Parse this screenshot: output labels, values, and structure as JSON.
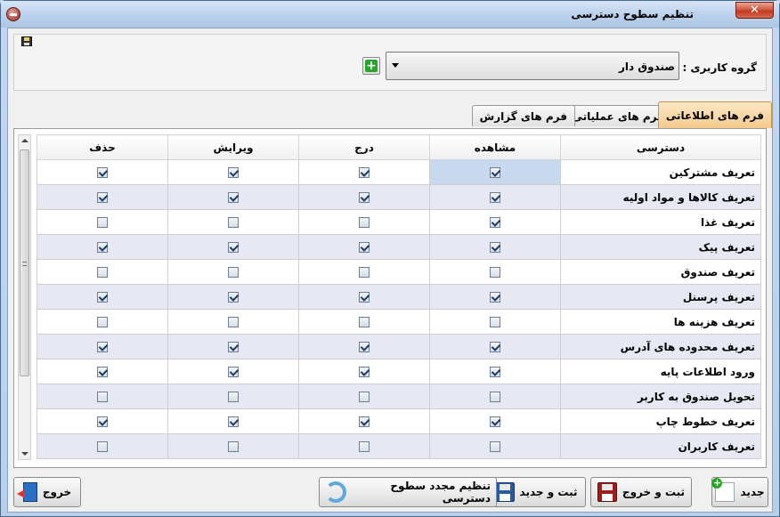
{
  "window": {
    "title": "تنظیم سطوح دسترسی",
    "close_label": "✕"
  },
  "group": {
    "label": "گروه کاربری :",
    "selected": "صندوق دار"
  },
  "tabs": [
    {
      "label": "فرم های اطلاعاتی",
      "active": true
    },
    {
      "label": "فرم های عملیاتی",
      "active": false
    },
    {
      "label": "فرم های گزارش",
      "active": false
    }
  ],
  "grid": {
    "columns": {
      "access": "دسترسی",
      "view": "مشاهده",
      "insert": "درج",
      "edit": "ویرایش",
      "delete": "حذف"
    },
    "rows": [
      {
        "name": "تعریف مشترکین",
        "view": true,
        "insert": true,
        "edit": true,
        "delete": true
      },
      {
        "name": "تعریف کالاها و مواد اولیه",
        "view": true,
        "insert": true,
        "edit": true,
        "delete": true
      },
      {
        "name": "تعریف غذا",
        "view": true,
        "insert": false,
        "edit": false,
        "delete": false
      },
      {
        "name": "تعریف پیک",
        "view": true,
        "insert": true,
        "edit": true,
        "delete": true
      },
      {
        "name": "تعریف صندوق",
        "view": false,
        "insert": false,
        "edit": false,
        "delete": false
      },
      {
        "name": "تعریف پرسنل",
        "view": true,
        "insert": true,
        "edit": true,
        "delete": true
      },
      {
        "name": "تعریف هزینه ها",
        "view": false,
        "insert": false,
        "edit": false,
        "delete": false
      },
      {
        "name": "تعریف محدوده های آدرس",
        "view": true,
        "insert": true,
        "edit": true,
        "delete": true
      },
      {
        "name": "ورود اطلاعات پایه",
        "view": true,
        "insert": true,
        "edit": true,
        "delete": true
      },
      {
        "name": "تحویل صندوق به کاربر",
        "view": false,
        "insert": false,
        "edit": false,
        "delete": false
      },
      {
        "name": "تعریف خطوط چاپ",
        "view": true,
        "insert": true,
        "edit": true,
        "delete": true
      },
      {
        "name": "تعریف کاربران",
        "view": false,
        "insert": false,
        "edit": false,
        "delete": false
      }
    ]
  },
  "buttons": {
    "new": "جدید",
    "save_exit": "ثبت و خروج",
    "save_new": "ثبت و جدید",
    "reset": "تنظیم مجدد سطوح دسترسی",
    "exit": "خروج"
  }
}
